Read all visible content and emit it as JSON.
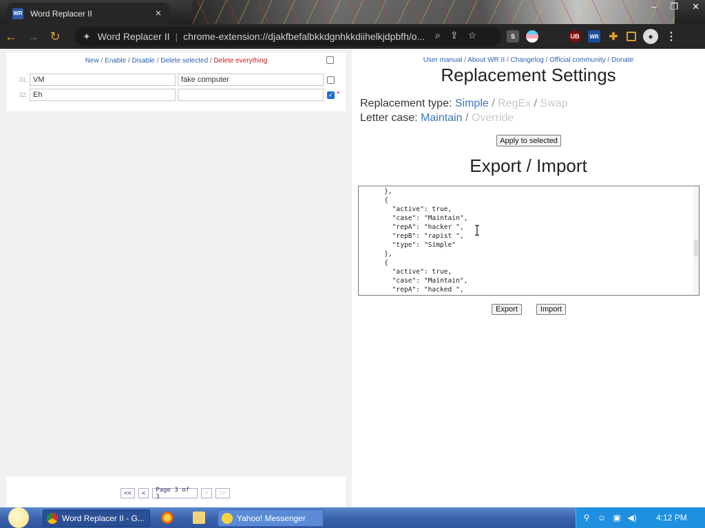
{
  "browser": {
    "tab_title": "Word Replacer II",
    "tab_favicon_text": "WR",
    "omnibox_site": "Word Replacer II",
    "omnibox_url": "chrome-extension://djakfbefalbkkdgnhkkdiihelkjdpbfh/o...",
    "ext_s_label": "S",
    "ext_ub_label": "UB",
    "ext_wr_label": "WR"
  },
  "left": {
    "actions": {
      "new": "New",
      "enable": "Enable",
      "disable": "Disable",
      "delete_selected": "Delete selected",
      "delete_everything": "Delete everything"
    },
    "rules": [
      {
        "num": "31.",
        "find": "VM",
        "replace": "fake computer",
        "checked": false,
        "star": ""
      },
      {
        "num": "32.",
        "find": "Eh",
        "replace": "",
        "checked": true,
        "star": "*"
      }
    ],
    "pager": {
      "first": "<<",
      "prev": "<",
      "info": "Page 3 of 3",
      "next": ">",
      "last": ">>"
    }
  },
  "right": {
    "links": {
      "manual": "User manual",
      "about": "About WR II",
      "changelog": "Changelog",
      "community": "Official community",
      "donate": "Donate"
    },
    "settings_title": "Replacement Settings",
    "type_label": "Replacement type:",
    "type_options": [
      "Simple",
      "RegEx",
      "Swap"
    ],
    "case_label": "Letter case:",
    "case_options": [
      "Maintain",
      "Override"
    ],
    "apply_button": "Apply to selected",
    "export_title": "Export / Import",
    "json_text": "    },\n    {\n      \"active\": true,\n      \"case\": \"Maintain\",\n      \"repA\": \"hacker \",\n      \"repB\": \"rapist \",\n      \"type\": \"Simple\"\n    },\n    {\n      \"active\": true,\n      \"case\": \"Maintain\",\n      \"repA\": \"hacked \",",
    "export_button": "Export",
    "import_button": "Import"
  },
  "taskbar": {
    "task1": "Word Replacer II - G...",
    "task2": "Yahoo! Messenger",
    "clock": "4:12 PM"
  },
  "colors": {
    "link": "#2e62b0",
    "danger": "#c21c1c",
    "option_active": "#3b76c0",
    "option_inactive": "#c8c8c8"
  }
}
